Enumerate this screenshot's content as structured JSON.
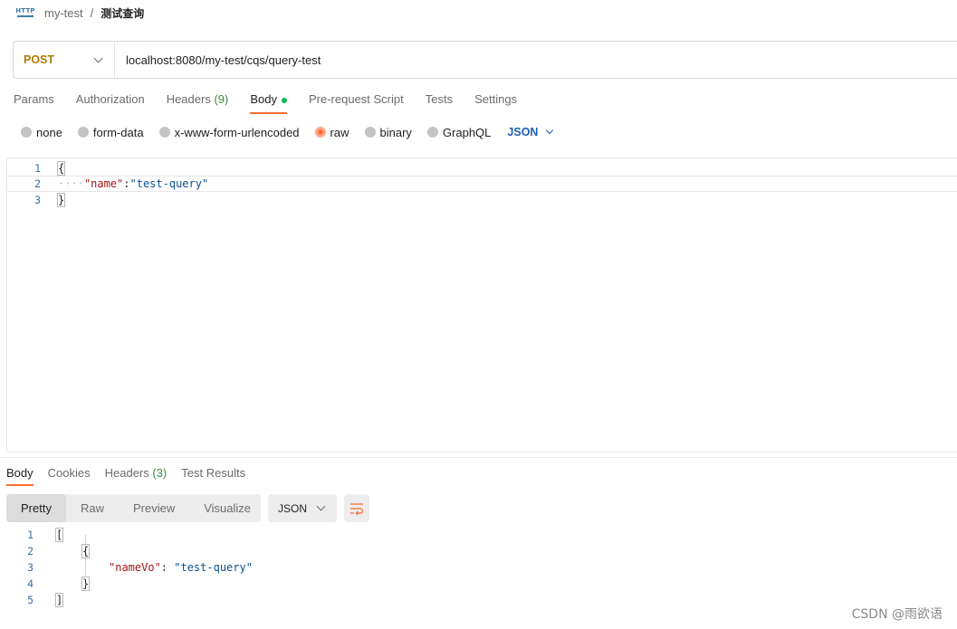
{
  "breadcrumb": {
    "icon": "http-request-icon",
    "icon_text": "HTTP",
    "parent": "my-test",
    "separator": "/",
    "current": "测试查询"
  },
  "request": {
    "method": "POST",
    "url": "localhost:8080/my-test/cqs/query-test"
  },
  "request_tabs": [
    {
      "label": "Params"
    },
    {
      "label": "Authorization"
    },
    {
      "label": "Headers",
      "count": "(9)"
    },
    {
      "label": "Body",
      "active": true
    },
    {
      "label": "Pre-request Script"
    },
    {
      "label": "Tests"
    },
    {
      "label": "Settings"
    }
  ],
  "body_types": {
    "options": [
      "none",
      "form-data",
      "x-www-form-urlencoded",
      "raw",
      "binary",
      "GraphQL"
    ],
    "selected": "raw",
    "language": "JSON"
  },
  "request_body": {
    "lines": [
      {
        "num": "1",
        "text": "{"
      },
      {
        "num": "2",
        "key": "\"name\"",
        "colon": ":",
        "value": "\"test-query\"",
        "indent_dots": "····"
      },
      {
        "num": "3",
        "text": "}"
      }
    ]
  },
  "response_tabs": [
    {
      "label": "Body",
      "active": true
    },
    {
      "label": "Cookies"
    },
    {
      "label": "Headers",
      "count": "(3)"
    },
    {
      "label": "Test Results"
    }
  ],
  "response_view": {
    "modes": [
      "Pretty",
      "Raw",
      "Preview",
      "Visualize"
    ],
    "selected": "Pretty",
    "format": "JSON"
  },
  "response_body": {
    "lines": [
      {
        "num": "1",
        "text": "["
      },
      {
        "num": "2",
        "text": "{"
      },
      {
        "num": "3",
        "key": "\"nameVo\"",
        "colon": ": ",
        "value": "\"test-query\""
      },
      {
        "num": "4",
        "text": "}"
      },
      {
        "num": "5",
        "text": "]"
      }
    ]
  },
  "watermark": "CSDN @雨欲语",
  "colors": {
    "accent": "#ff6c37",
    "method": "#ad7a03",
    "link_blue": "#1f5bb5",
    "count_green": "#3d8b3d",
    "dot_green": "#0cbb52"
  }
}
